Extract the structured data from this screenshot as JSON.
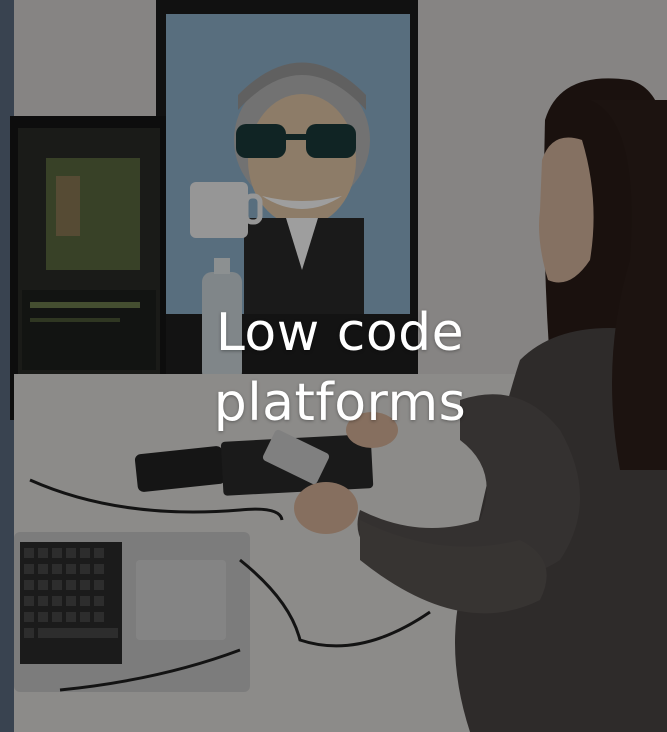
{
  "caption": {
    "line1": "Low code",
    "line2": "platforms"
  },
  "overlay_color": "#000000"
}
